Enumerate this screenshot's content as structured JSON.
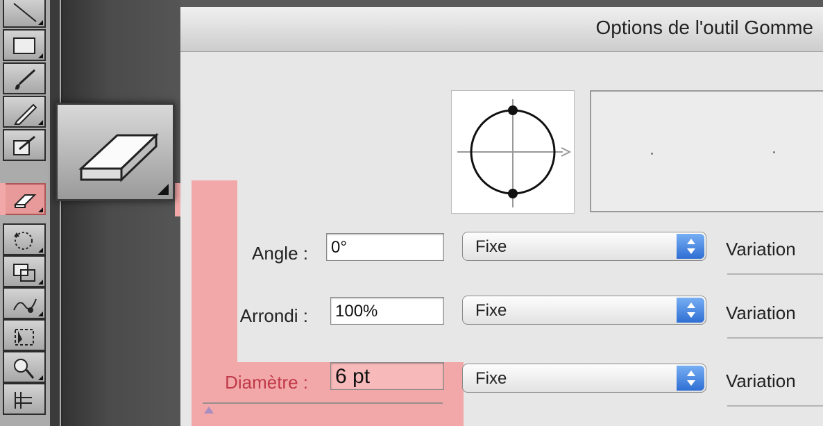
{
  "dialog": {
    "title": "Options de l'outil Gomme",
    "rows": [
      {
        "label": "Angle :",
        "value": "0°",
        "select": "Fixe",
        "variation": "Variation"
      },
      {
        "label": "Arrondi :",
        "value": "100%",
        "select": "Fixe",
        "variation": "Variation"
      },
      {
        "label": "Diamètre :",
        "value": "6 pt",
        "select": "Fixe",
        "variation": "Variation"
      }
    ]
  },
  "toolbar": {
    "icons": [
      "line-segment-icon",
      "rectangle-icon",
      "paintbrush-icon",
      "pencil-icon",
      "blob-brush-icon",
      "eraser-icon",
      "rotate-icon",
      "scale-icon",
      "warp-icon",
      "free-transform-icon",
      "shape-builder-icon",
      "perspective-grid-icon"
    ],
    "selected": "eraser-icon"
  },
  "colors": {
    "highlight": "#f2a8a8",
    "select_arrows": "#2f6fd4"
  }
}
